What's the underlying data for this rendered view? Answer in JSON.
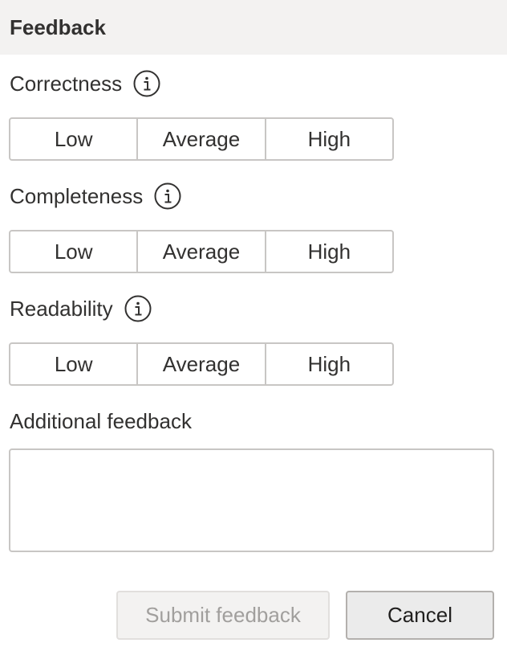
{
  "header": {
    "title": "Feedback"
  },
  "criteria": [
    {
      "label": "Correctness",
      "options": [
        "Low",
        "Average",
        "High"
      ]
    },
    {
      "label": "Completeness",
      "options": [
        "Low",
        "Average",
        "High"
      ]
    },
    {
      "label": "Readability",
      "options": [
        "Low",
        "Average",
        "High"
      ]
    }
  ],
  "additional": {
    "label": "Additional feedback",
    "value": "",
    "placeholder": ""
  },
  "actions": {
    "submit_label": "Submit feedback",
    "cancel_label": "Cancel",
    "submit_disabled": true
  },
  "icons": {
    "info": "info-circle-icon"
  },
  "colors": {
    "header_bg": "#f3f2f1",
    "border": "#c8c6c4",
    "text": "#323130",
    "disabled_text": "#a19f9d"
  }
}
